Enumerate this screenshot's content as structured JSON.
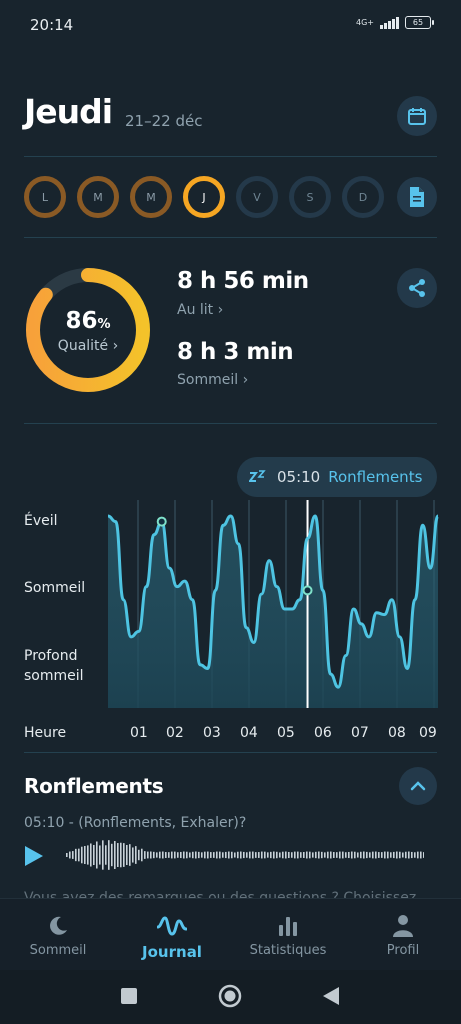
{
  "status": {
    "time": "20:14",
    "network": "4G+",
    "battery": "65"
  },
  "header": {
    "day": "Jeudi",
    "date_range": "21–22 déc"
  },
  "week": [
    {
      "label": "L",
      "state": "past"
    },
    {
      "label": "M",
      "state": "past"
    },
    {
      "label": "M",
      "state": "past"
    },
    {
      "label": "J",
      "state": "active"
    },
    {
      "label": "V",
      "state": "future"
    },
    {
      "label": "S",
      "state": "future"
    },
    {
      "label": "D",
      "state": "future"
    }
  ],
  "quality": {
    "percent": "86",
    "unit": "%",
    "label": "Qualité ›",
    "value": 0.86
  },
  "stats": {
    "in_bed_value": "8 h 56 min",
    "in_bed_label": "Au lit ›",
    "sleep_value": "8 h 3 min",
    "sleep_label": "Sommeil ›"
  },
  "snore_pill": {
    "time": "05:10",
    "label": "Ronflements",
    "icon": "zzz-icon"
  },
  "chart_data": {
    "type": "line",
    "y_levels": [
      "Éveil",
      "Sommeil",
      "Profond sommeil"
    ],
    "x_label": "Heure",
    "x_ticks": [
      "01",
      "02",
      "03",
      "04",
      "05",
      "06",
      "07",
      "08",
      "09"
    ],
    "series": [
      {
        "values": [
          1.0,
          0.97,
          0.55,
          0.35,
          0.38,
          0.62,
          0.9,
          0.97,
          0.72,
          0.62,
          0.65,
          0.55,
          0.2,
          0.18,
          0.6,
          0.95,
          1.0,
          0.85,
          0.4,
          0.32,
          0.58,
          0.76,
          0.62,
          0.5,
          0.5,
          0.55,
          0.88,
          1.0,
          0.6,
          0.15,
          0.08,
          0.25,
          0.5,
          0.42,
          0.35,
          0.48,
          0.47,
          0.55,
          0.35,
          0.18,
          0.55,
          0.95,
          0.72,
          1.0
        ]
      }
    ],
    "markers": [
      {
        "index": 7,
        "value": 0.97
      },
      {
        "index": 26,
        "value": 0.6
      }
    ],
    "cursor_index": 26
  },
  "snoring": {
    "title": "Ronflements",
    "entry": "05:10 - (Ronflements, Exhaler)?",
    "faded_text": "Vous avez des remarques ou des questions ? Choisissez"
  },
  "tabs": [
    {
      "label": "Sommeil",
      "icon": "moon-icon",
      "active": false
    },
    {
      "label": "Journal",
      "icon": "pulse-icon",
      "active": true
    },
    {
      "label": "Statistiques",
      "icon": "bar-chart-icon",
      "active": false
    },
    {
      "label": "Profil",
      "icon": "person-icon",
      "active": false
    }
  ],
  "colors": {
    "background": "#18242d",
    "accent": "#58c3ec",
    "orange": "#f5a623",
    "orange_dim": "#8a5a25"
  }
}
